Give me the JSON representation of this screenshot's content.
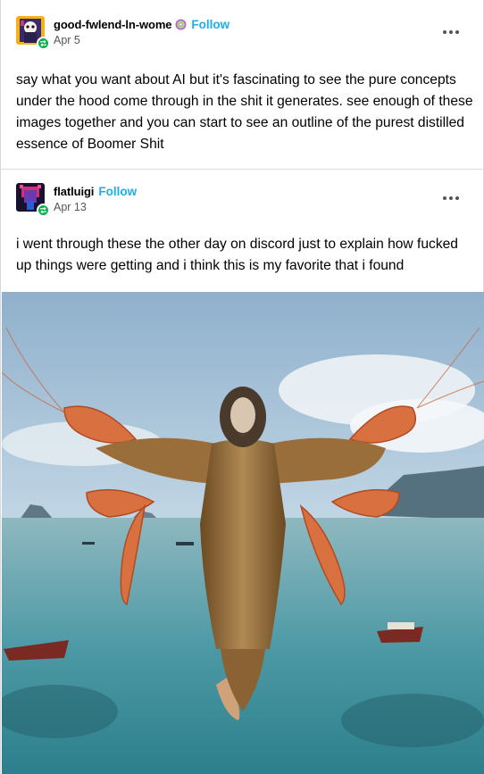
{
  "posts": [
    {
      "username": "good-fwlend-ln-wome",
      "follow_label": "Follow",
      "date": "Apr 5",
      "text": "say what you want about AI but it's fascinating to see the pure concepts under the hood come through in the shit it generates. see enough of these images together and you can start to see an outline of the purest distilled essence of Boomer Shit"
    },
    {
      "username": "flatluigi",
      "follow_label": "Follow",
      "date": "Apr 13",
      "text": "i went through these the other day on discord just to explain how fucked up things were getting and i think this is my favorite that i found"
    }
  ],
  "colors": {
    "follow": "#1eaeea",
    "reblog_badge": "#00b34d",
    "pride_badge": "#a56be0"
  },
  "icons": {
    "reblog": "reblog-icon",
    "more": "more-options-icon",
    "pride": "pride-badge-icon"
  }
}
